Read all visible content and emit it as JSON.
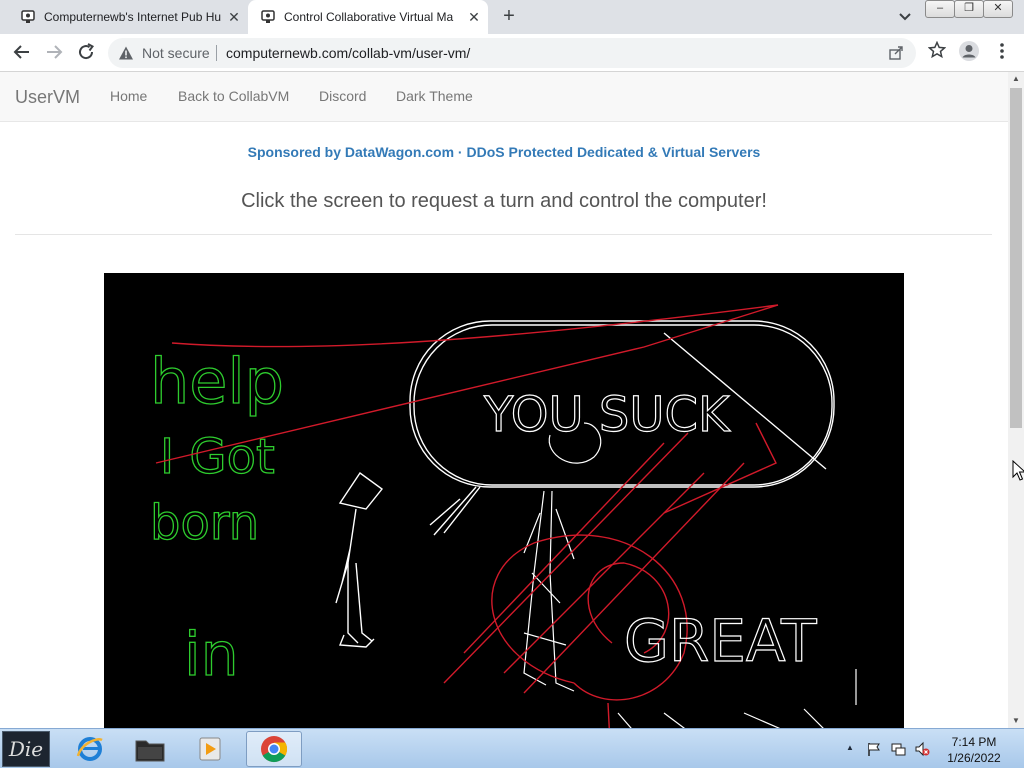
{
  "browser": {
    "tabs": [
      {
        "title": "Computernewb's Internet Pub Hu",
        "active": false
      },
      {
        "title": "Control Collaborative Virtual Ma",
        "active": true
      }
    ],
    "address": {
      "security_label": "Not secure",
      "url": "computernewb.com/collab-vm/user-vm/"
    }
  },
  "navbar": {
    "brand": "UserVM",
    "links": [
      "Home",
      "Back to CollabVM",
      "Discord",
      "Dark Theme"
    ]
  },
  "main": {
    "sponsor": "Sponsored by DataWagon.com · DDoS Protected Dedicated & Virtual Servers",
    "instruction": "Click the screen to request a turn and control the computer!",
    "vm_drawing": {
      "green_text": [
        "help",
        "I Got",
        "born",
        "in"
      ],
      "speech_bubble_text": "YOU SUCK",
      "white_text": "GREAT"
    }
  },
  "taskbar": {
    "start_label": "Die",
    "apps": [
      "internet-explorer",
      "file-explorer",
      "media-player",
      "google-chrome"
    ],
    "clock": {
      "time": "7:14 PM",
      "date": "1/26/2022"
    }
  },
  "colors": {
    "link": "#337ab7",
    "drawing_green": "#2ecc2e",
    "drawing_red": "#d11a2a"
  }
}
